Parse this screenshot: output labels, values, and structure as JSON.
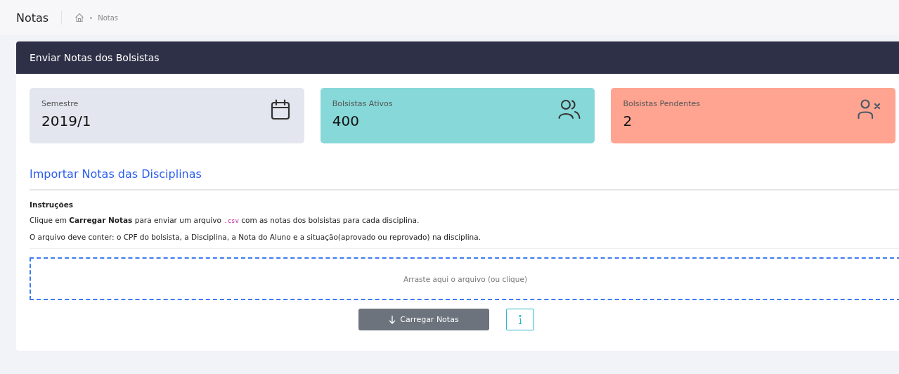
{
  "page_title": "Notas",
  "breadcrumb": [
    "Notas"
  ],
  "panel": {
    "title": "Enviar Notas dos Bolsistas"
  },
  "stats": [
    {
      "kind": "calendar",
      "label": "Semestre",
      "value": "2019/1",
      "color": "#e3e6ee"
    },
    {
      "kind": "users",
      "label": "Bolsistas Ativos",
      "value": "400",
      "color": "#87d8d8"
    },
    {
      "kind": "user-x",
      "label": "Bolsistas Pendentes",
      "value": "2",
      "color": "#ffa491"
    }
  ],
  "section_title": "Importar Notas das Disciplinas",
  "instructions_title": "Instruções",
  "instructions": [
    [
      {
        "kind": "text",
        "text": "Clique em "
      },
      {
        "kind": "bold",
        "text": "Carregar Notas"
      },
      {
        "kind": "text",
        "text": " para enviar um arquivo "
      },
      {
        "kind": "code",
        "text": ".csv"
      },
      {
        "kind": "text",
        "text": " com as notas dos bolsistas para cada disciplina."
      }
    ],
    [
      {
        "kind": "text",
        "text": "O arquivo deve conter: o CPF do bolsista, a Disciplina, a Nota do Aluno e a situação(aprovado ou reprovado) na disciplina."
      }
    ]
  ],
  "dropzone": "Arraste aqui o arquivo (ou clique)",
  "upload_button": "Carregar Notas"
}
